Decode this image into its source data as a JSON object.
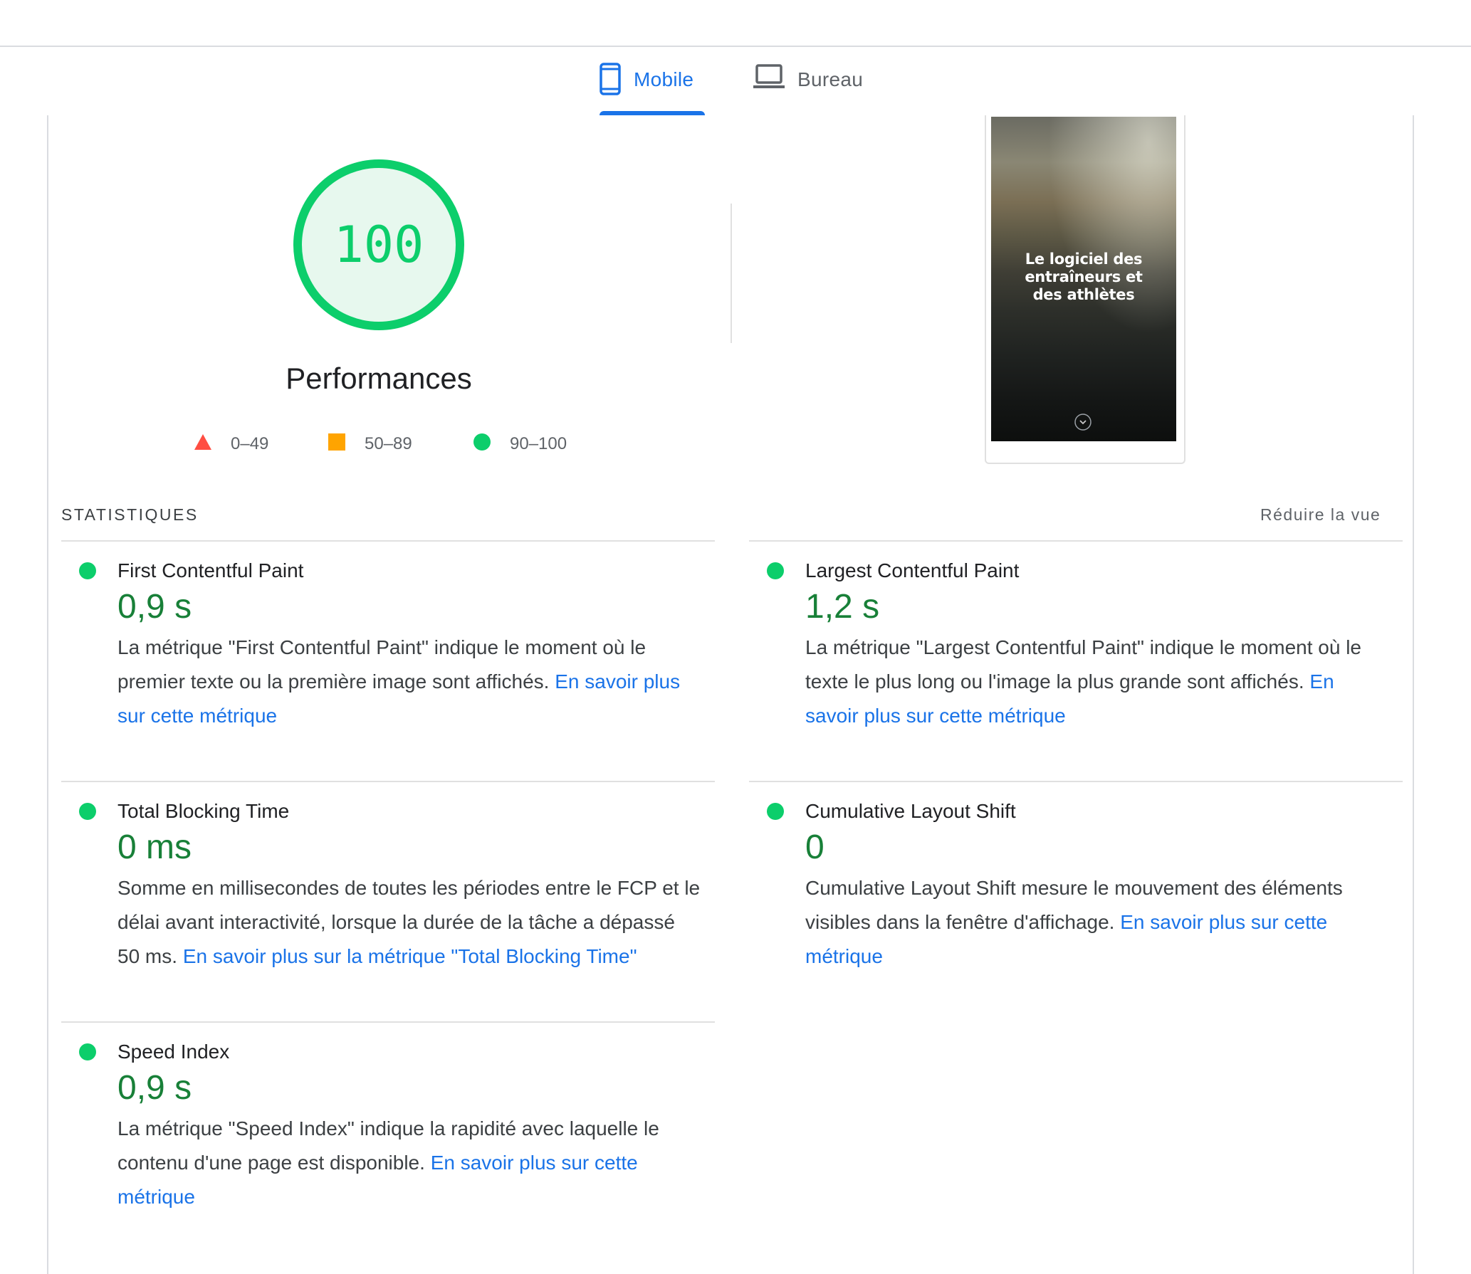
{
  "tabs": [
    {
      "label": "Mobile",
      "icon": "smartphone-icon",
      "selected": true
    },
    {
      "label": "Bureau",
      "icon": "laptop-icon",
      "selected": false
    }
  ],
  "performance": {
    "score": "100",
    "score_value": 100,
    "title": "Performances",
    "color": "#0cce6b"
  },
  "legend": [
    {
      "label": "0–49",
      "shape": "triangle",
      "color": "#ff4e42"
    },
    {
      "label": "50–89",
      "shape": "square",
      "color": "#ffa400"
    },
    {
      "label": "90–100",
      "shape": "circle",
      "color": "#0cce6b"
    }
  ],
  "screenshot": {
    "lines": [
      "Le logiciel des",
      "entraîneurs et",
      "des athlètes"
    ]
  },
  "stats": {
    "title": "STATISTIQUES",
    "collapse_label": "Réduire la vue"
  },
  "metrics": {
    "fcp": {
      "title": "First Contentful Paint",
      "value": "0,9 s",
      "description": "La métrique \"First Contentful Paint\" indique le moment où le premier texte ou la première image sont affichés. ",
      "link": "En savoir plus sur cette métrique"
    },
    "lcp": {
      "title": "Largest Contentful Paint",
      "value": "1,2 s",
      "description": "La métrique \"Largest Contentful Paint\" indique le moment où le texte le plus long ou l'image la plus grande sont affichés. ",
      "link": "En savoir plus sur cette métrique"
    },
    "tbt": {
      "title": "Total Blocking Time",
      "value": "0 ms",
      "description": "Somme en millisecondes de toutes les périodes entre le FCP et le délai avant interactivité, lorsque la durée de la tâche a dépassé 50 ms. ",
      "link": "En savoir plus sur la métrique \"Total Blocking Time\""
    },
    "cls": {
      "title": "Cumulative Layout Shift",
      "value": "0",
      "description": "Cumulative Layout Shift mesure le mouvement des éléments visibles dans la fenêtre d'affichage. ",
      "link": "En savoir plus sur cette métrique"
    },
    "si": {
      "title": "Speed Index",
      "value": "0,9 s",
      "description": "La métrique \"Speed Index\" indique la rapidité avec laquelle le contenu d'une page est disponible. ",
      "link": "En savoir plus sur cette métrique"
    }
  }
}
